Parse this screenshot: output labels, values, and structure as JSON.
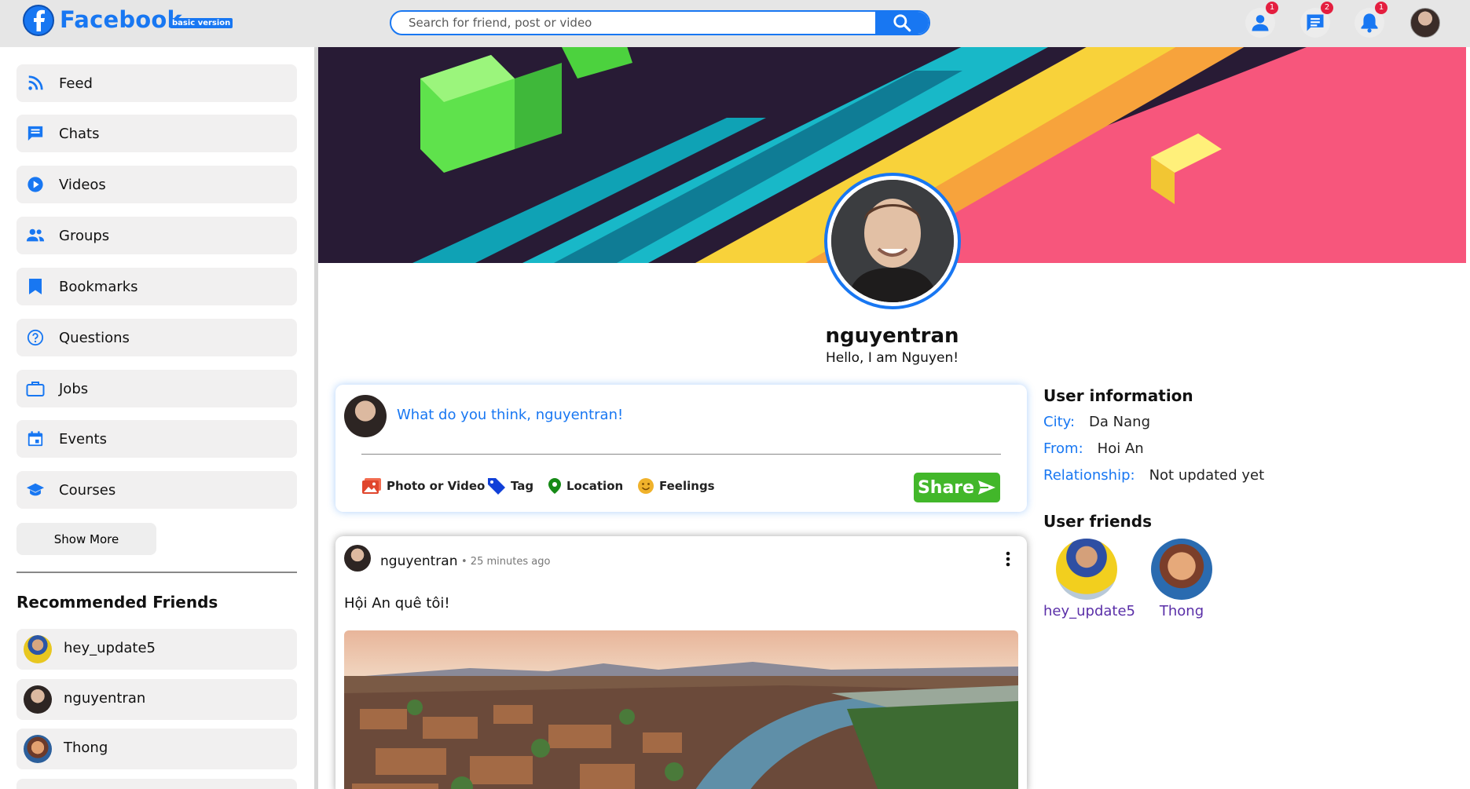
{
  "header": {
    "brand": "Facebook",
    "brand_badge": "basic version",
    "search_placeholder": "Search for friend, post or video",
    "notifications": {
      "friends": "1",
      "messages": "2",
      "alerts": "1"
    }
  },
  "sidebar": {
    "items": [
      {
        "label": "Feed",
        "icon": "rss-icon"
      },
      {
        "label": "Chats",
        "icon": "chat-icon"
      },
      {
        "label": "Videos",
        "icon": "play-circle-icon"
      },
      {
        "label": "Groups",
        "icon": "group-icon"
      },
      {
        "label": "Bookmarks",
        "icon": "bookmark-icon"
      },
      {
        "label": "Questions",
        "icon": "question-icon"
      },
      {
        "label": "Jobs",
        "icon": "briefcase-icon"
      },
      {
        "label": "Events",
        "icon": "calendar-icon"
      },
      {
        "label": "Courses",
        "icon": "graduation-cap-icon"
      }
    ],
    "show_more": "Show More",
    "recommended_title": "Recommended Friends",
    "recommended": [
      {
        "name": "hey_update5"
      },
      {
        "name": "nguyentran"
      },
      {
        "name": "Thong"
      }
    ]
  },
  "profile": {
    "username": "nguyentran",
    "bio": "Hello, I am Nguyen!"
  },
  "composer": {
    "prompt": "What do you think, nguyentran!",
    "options": [
      "Photo or Video",
      "Tag",
      "Location",
      "Feelings"
    ],
    "share_label": "Share"
  },
  "post": {
    "author": "nguyentran",
    "time": "• 25 minutes ago",
    "text": "Hội An quê tôi!"
  },
  "user_info": {
    "title": "User information",
    "city_label": "City:",
    "city": "Da Nang",
    "from_label": "From:",
    "from": "Hoi An",
    "relationship_label": "Relationship:",
    "relationship": "Not updated yet"
  },
  "user_friends": {
    "title": "User friends",
    "list": [
      {
        "name": "hey_update5"
      },
      {
        "name": "Thong"
      }
    ]
  },
  "colors": {
    "accent": "#1877f2",
    "share": "#42b72a",
    "badge": "#e41e3f",
    "friend_name": "#5a2fa8"
  }
}
